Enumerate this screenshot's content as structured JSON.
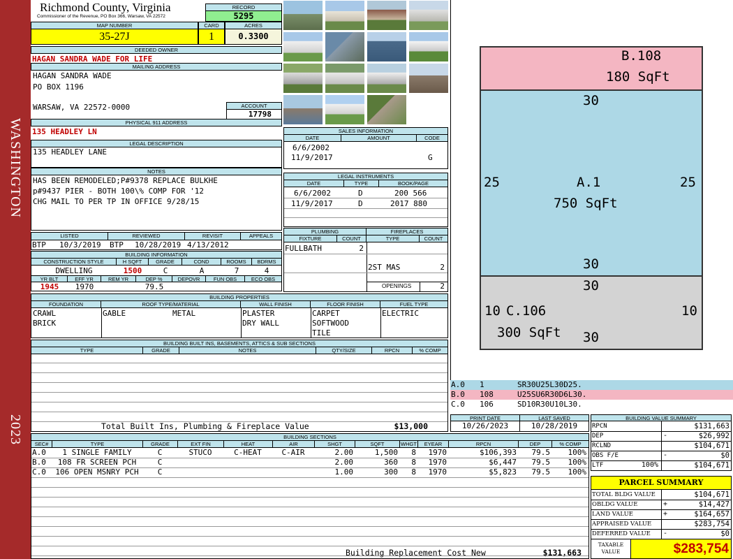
{
  "side": {
    "district": "WASHINGTON",
    "year": "2023"
  },
  "header": {
    "county": "Richmond County, Virginia",
    "commissioner": "Commissioner of the Revenue, PO Box 366, Warsaw, VA 22572",
    "record_label": "RECORD",
    "record": "5295",
    "map_label": "MAP NUMBER",
    "map_number": "35-27J",
    "card_label": "CARD",
    "card": "1",
    "acres_label": "ACRES",
    "acres": "0.3300"
  },
  "owner": {
    "deeded_label": "DEEDED OWNER",
    "deeded": "HAGAN SANDRA WADE FOR LIFE",
    "mailing_label": "MAILING ADDRESS",
    "mailing_1": "HAGAN SANDRA WADE",
    "mailing_2": "PO BOX 1196",
    "mailing_3": "WARSAW, VA 22572-0000",
    "account_label": "ACCOUNT",
    "account": "17798",
    "physical_label": "PHYSICAL 911 ADDRESS",
    "physical": "135 HEADLEY LN"
  },
  "legal": {
    "label": "LEGAL DESCRIPTION",
    "text": "135 HEADLEY LANE"
  },
  "notes": {
    "label": "NOTES",
    "lines": [
      "HAS BEEN REMODELED;P#9378 REPLACE BULKHE",
      "p#9437 PIER - BOTH 100\\% COMP FOR '12",
      "CHG MAIL TO PER TP IN OFFICE 9/28/15"
    ]
  },
  "review": {
    "listed_label": "LISTED",
    "listed_by": "BTP",
    "listed": "10/3/2019",
    "reviewed_label": "REVIEWED",
    "reviewed_by": "BTP",
    "reviewed": "10/28/2019",
    "revisit_label": "REVISIT",
    "revisit": "4/13/2012",
    "appeals_label": "APPEALS",
    "appeals": ""
  },
  "building_info": {
    "label": "BUILDING INFORMATION",
    "h": [
      "CONSTRUCTION STYLE",
      "H SQFT",
      "GRADE",
      "COND",
      "ROOMS",
      "BDRMS"
    ],
    "v": [
      "DWELLING",
      "1500",
      "C",
      "A",
      "7",
      "4"
    ],
    "h2": [
      "YR BLT",
      "EFF YR",
      "REM YR",
      "DEP %",
      "DEPOVR",
      "FUN OBS",
      "ECO OBS"
    ],
    "v2": [
      "1945",
      "1970",
      "",
      "79.5",
      "",
      "",
      ""
    ]
  },
  "sales": {
    "label": "SALES INFORMATION",
    "h": [
      "DATE",
      "AMOUNT",
      "CODE"
    ],
    "rows": [
      [
        "6/6/2002",
        "",
        ""
      ],
      [
        "11/9/2017",
        "",
        "G"
      ]
    ]
  },
  "instruments": {
    "label": "LEGAL INSTRUMENTS",
    "h": [
      "DATE",
      "TYPE",
      "BOOK/PAGE"
    ],
    "rows": [
      [
        "6/6/2002",
        "D",
        "200 566"
      ],
      [
        "11/9/2017",
        "D",
        "2017 880"
      ]
    ]
  },
  "plumbing": {
    "label": "PLUMBING",
    "h": [
      "FIXTURE",
      "COUNT"
    ],
    "fixture": "FULLBATH",
    "count": "2"
  },
  "fireplaces": {
    "label": "FIREPLACES",
    "h": [
      "TYPE",
      "COUNT"
    ],
    "type": "2ST MAS",
    "count": "2",
    "openings_label": "OPENINGS",
    "openings": "2"
  },
  "properties": {
    "label": "BUILDING PROPERTIES",
    "h": [
      "FOUNDATION",
      "ROOF TYPE/MATERIAL",
      "WALL FINISH",
      "FLOOR FINISH",
      "FUEL TYPE"
    ],
    "foundation": [
      "CRAWL",
      "BRICK"
    ],
    "roof_type": "GABLE",
    "roof_material": "METAL",
    "wall": [
      "PLASTER",
      "DRY WALL"
    ],
    "floor": [
      "CARPET",
      "SOFTWOOD",
      "TILE"
    ],
    "fuel": "ELECTRIC"
  },
  "builtins": {
    "label": "BUILDING BUILT INS, BASEMENTS, ATTICS & SUB SECTIONS",
    "h": [
      "TYPE",
      "GRADE",
      "NOTES",
      "QTY/SIZE",
      "RPCN",
      "% COMP"
    ],
    "total_label": "Total Built Ins, Plumbing & Fireplace Value",
    "total": "$13,000"
  },
  "dates": {
    "print_label": "PRINT DATE",
    "print": "10/26/2023",
    "saved_label": "LAST SAVED",
    "saved": "10/28/2019"
  },
  "sections": {
    "label": "BUILDING SECTIONS",
    "h": [
      "SEC#",
      "TYPE",
      "GRADE",
      "EXT FIN",
      "HEAT",
      "AIR",
      "SHGT",
      "SQFT",
      "WHGT",
      "EYEAR",
      "RPCN",
      "DEP",
      "% COMP"
    ],
    "rows": [
      [
        "A.0",
        "1 SINGLE FAMILY",
        "C",
        "STUCO",
        "C-HEAT",
        "C-AIR",
        "2.00",
        "1,500",
        "8",
        "1970",
        "$106,393",
        "79.5",
        "100%"
      ],
      [
        "B.0",
        "108 FR SCREEN PCH",
        "C",
        "",
        "",
        "",
        "2.00",
        "360",
        "8",
        "1970",
        "$6,447",
        "79.5",
        "100%"
      ],
      [
        "C.0",
        "106 OPEN MSNRY PCH",
        "C",
        "",
        "",
        "",
        "1.00",
        "300",
        "8",
        "1970",
        "$5,823",
        "79.5",
        "100%"
      ]
    ],
    "replacement_label": "Building Replacement Cost New",
    "replacement": "$131,663"
  },
  "sketch": {
    "b": {
      "name": "B.108",
      "area": "180 SqFt"
    },
    "a": {
      "name": "A.1",
      "area": "750 SqFt",
      "top": "30",
      "bottom": "30",
      "left": "25",
      "right": "25"
    },
    "c": {
      "name": "C.106",
      "area": "300 SqFt",
      "top": "30",
      "bottom": "30",
      "left": "10",
      "right": "10"
    },
    "colors": {
      "a": "#add8e6",
      "b": "#f4b6c2",
      "c": "#d3d3d3"
    }
  },
  "vectors": [
    {
      "sec": "A.0",
      "code": "1",
      "path": "SR30U25L30D25.",
      "color": "#add8e6"
    },
    {
      "sec": "B.0",
      "code": "108",
      "path": "U25SU6R30D6L30.",
      "color": "#f4b6c2"
    },
    {
      "sec": "C.0",
      "code": "106",
      "path": "SD10R30U10L30.",
      "color": "#ffffff"
    }
  ],
  "bvs": {
    "label": "BUILDING VALUE SUMMARY",
    "rows": [
      [
        "RPCN",
        "",
        "",
        "$131,663"
      ],
      [
        "DEP",
        "",
        "-",
        "$26,992"
      ],
      [
        "RCLND",
        "",
        "",
        "$104,671"
      ],
      [
        "OBS F/E",
        "",
        "-",
        "$0"
      ],
      [
        "LTF",
        "100%",
        "",
        "$104,671"
      ]
    ]
  },
  "parcel": {
    "label": "PARCEL SUMMARY",
    "rows": [
      [
        "TOTAL BLDG VALUE",
        "",
        "$104,671"
      ],
      [
        "OBLDG VALUE",
        "+",
        "$14,427"
      ],
      [
        "LAND VALUE",
        "+",
        "$164,657"
      ],
      [
        "APPRAISED VALUE",
        "",
        "$283,754"
      ],
      [
        "DEFERRED VALUE",
        "-",
        "$0"
      ]
    ],
    "taxable_label_1": "TAXABLE",
    "taxable_label_2": "VALUE",
    "taxable": "$283,754"
  }
}
